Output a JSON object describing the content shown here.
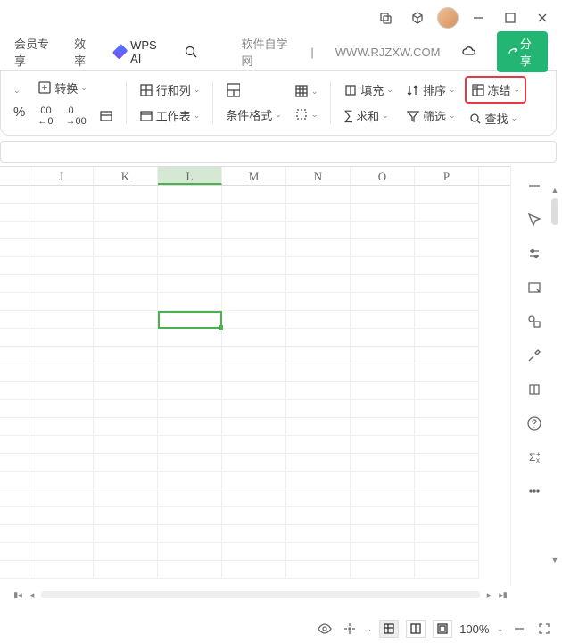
{
  "titlebar": {},
  "menubar": {
    "member": "会员专享",
    "efficiency": "效率",
    "wpsai": "WPS AI",
    "site_label": "软件自学网",
    "site_url": "WWW.RJZXW.COM",
    "share": "分享"
  },
  "ribbon": {
    "convert": "转换",
    "rowcol": "行和列",
    "worksheet": "工作表",
    "condformat": "条件格式",
    "fill": "填充",
    "sort": "排序",
    "freeze": "冻结",
    "sum": "求和",
    "filter": "筛选",
    "find": "查找"
  },
  "columns": [
    "J",
    "K",
    "L",
    "M",
    "N",
    "O",
    "P"
  ],
  "selected_col": "L",
  "status": {
    "zoom": "100%"
  }
}
